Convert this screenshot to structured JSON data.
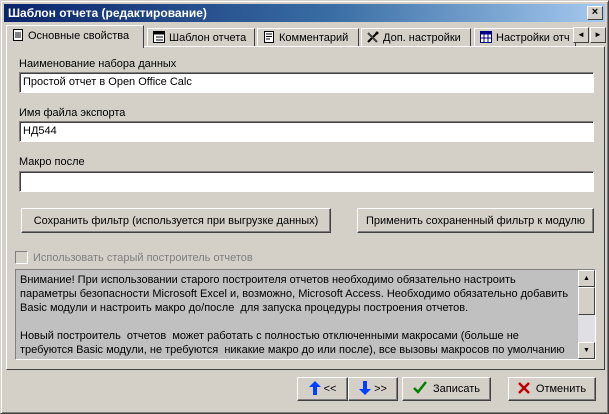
{
  "window": {
    "title": "Шаблон отчета (редактирование)",
    "close_glyph": "×"
  },
  "tabs": [
    {
      "label": "Основные свойства",
      "icon": "document-icon"
    },
    {
      "label": "Шаблон отчета",
      "icon": "template-icon"
    },
    {
      "label": "Комментарий",
      "icon": "note-icon"
    },
    {
      "label": "Доп. настройки",
      "icon": "tools-icon"
    },
    {
      "label": "Настройки отч",
      "icon": "table-icon"
    }
  ],
  "tab_scroll": {
    "left": "◄",
    "right": "►"
  },
  "form": {
    "dataset_label": "Наименование набора данных",
    "dataset_value": "Простой отчет в Open Office Calc",
    "export_label": "Имя файла экспорта",
    "export_value": "НД544",
    "macro_label": "Макро после",
    "macro_value": ""
  },
  "buttons": {
    "save_filter": "Сохранить фильтр (используется при выгрузке данных)",
    "apply_filter": "Применить сохраненный фильтр к модулю",
    "old_builder": "Использовать старый построитель отчетов"
  },
  "memo": {
    "text": "Внимание! При использовании старого построителя отчетов необходимо обязательно настроить\nпараметры безопасности Microsoft Excel и, возможно, Microsoft Access. Необходимо обязательно добавить\nBasic модули и настроить макро до/после  для запуска процедуры построения отчетов.\n\nНовый построитель  отчетов  может работать с полностью отключенными макросами (больше не\nтребуются Basic модули, не требуются  никакие макро до или после), все вызовы макросов по умолчанию"
  },
  "footer": {
    "prev": "<<",
    "next": ">>",
    "save": "Записать",
    "cancel": "Отменить"
  },
  "colors": {
    "title_start": "#0a246a",
    "title_end": "#a6caf0",
    "arrow_blue": "#0040ff",
    "save_green": "#008000",
    "cancel_red": "#c00000"
  }
}
